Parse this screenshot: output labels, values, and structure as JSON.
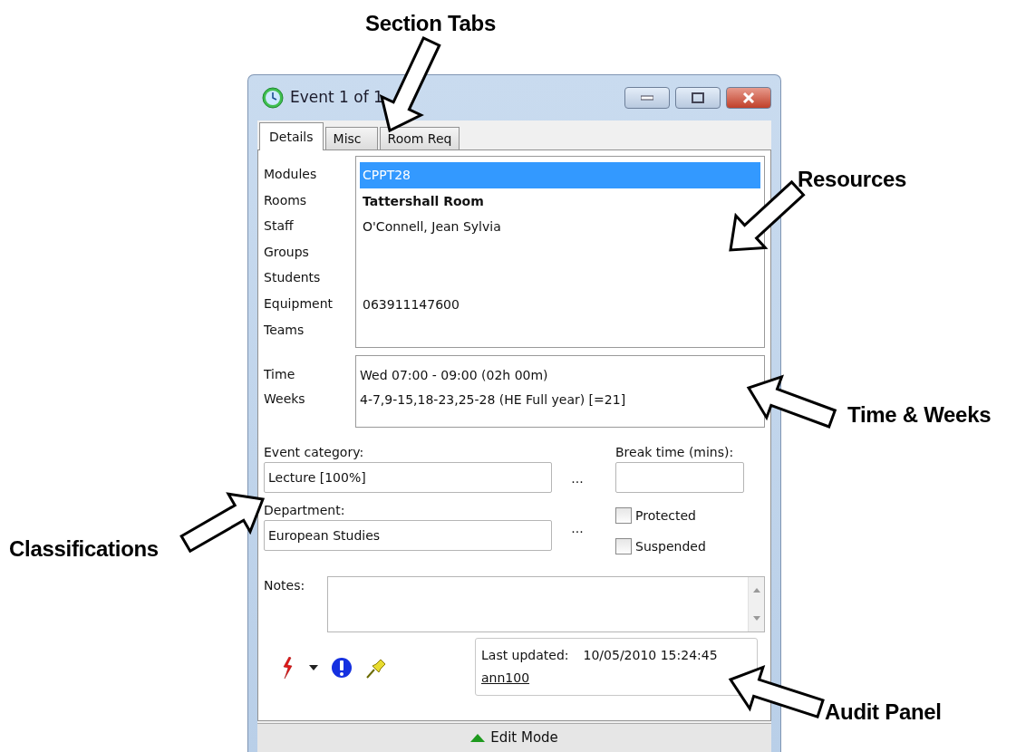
{
  "window": {
    "title": "Event 1 of 1"
  },
  "tabs": [
    {
      "label": "Details",
      "selected": true
    },
    {
      "label": "Misc",
      "selected": false
    },
    {
      "label": "Room Req",
      "selected": false
    }
  ],
  "resources": [
    {
      "label": "Modules",
      "value": "CPPT28",
      "selected": true,
      "bold": false
    },
    {
      "label": "Rooms",
      "value": "Tattershall Room",
      "selected": false,
      "bold": true
    },
    {
      "label": "Staff",
      "value": "O'Connell, Jean Sylvia",
      "selected": false,
      "bold": false
    },
    {
      "label": "Groups"
    },
    {
      "label": "Students"
    },
    {
      "label": "Equipment",
      "value": "063911147600",
      "selected": false,
      "bold": false
    },
    {
      "label": "Teams"
    }
  ],
  "timing": [
    {
      "label": "Time",
      "value": "Wed 07:00 - 09:00 (02h 00m)"
    },
    {
      "label": "Weeks",
      "value": "4-7,9-15,18-23,25-28 (HE Full year) [=21]"
    }
  ],
  "event_category": {
    "label": "Event category:",
    "value": "Lecture [100%]",
    "browse": "..."
  },
  "department": {
    "label": "Department:",
    "value": "European Studies",
    "browse": "..."
  },
  "break_time": {
    "label": "Break time (mins):"
  },
  "checkboxes": [
    {
      "label": "Protected",
      "checked": false
    },
    {
      "label": "Suspended",
      "checked": false
    }
  ],
  "notes": {
    "label": "Notes:"
  },
  "audit": {
    "label": "Last updated:",
    "timestamp": "10/05/2010 15:24:45",
    "user": "ann100"
  },
  "status_bar": {
    "label": "Edit Mode"
  },
  "annotations": [
    {
      "label": "Section Tabs"
    },
    {
      "label": "Resources"
    },
    {
      "label": "Time & Weeks"
    },
    {
      "label": "Classifications"
    },
    {
      "label": "Audit Panel"
    }
  ]
}
